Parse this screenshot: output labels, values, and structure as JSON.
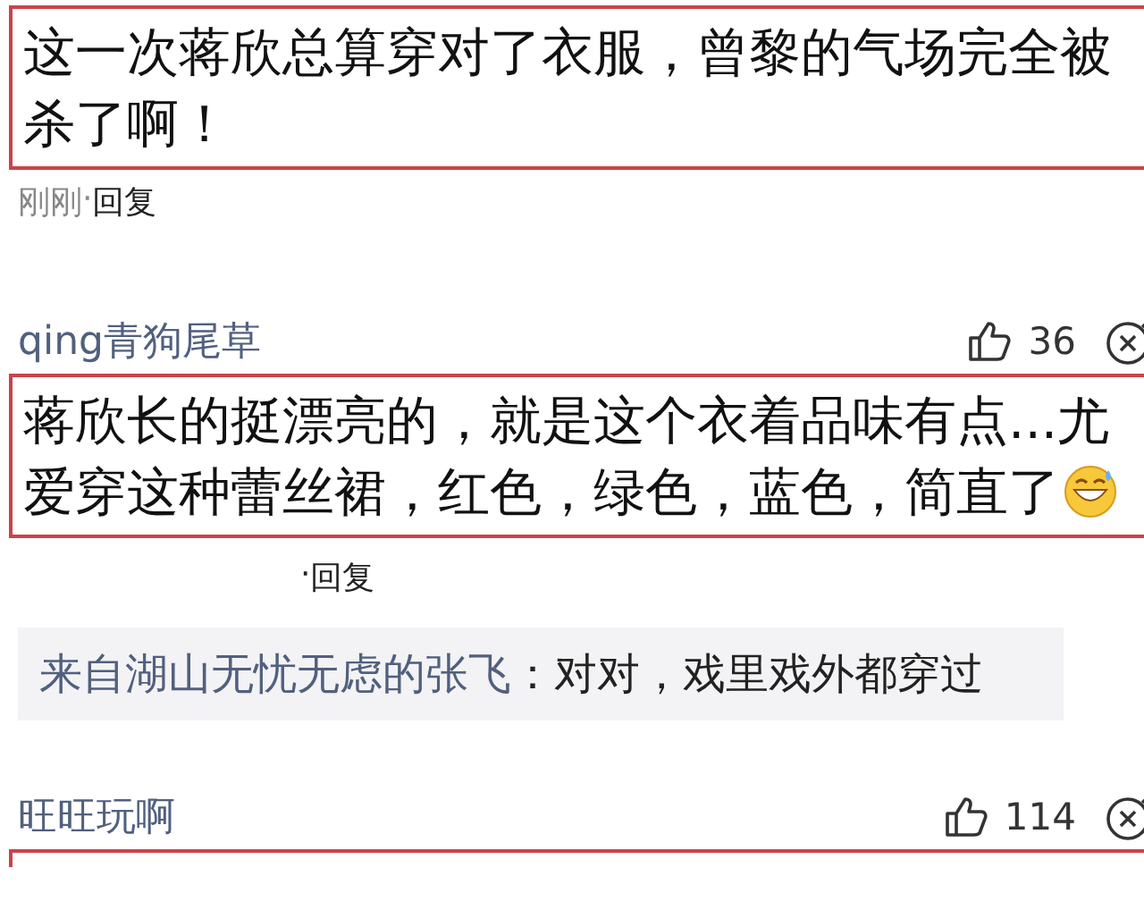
{
  "comments": [
    {
      "text_lines": [
        "这一次蒋欣总算穿对了衣服，曾黎的气场完全被",
        "杀了啊！"
      ],
      "time": "刚刚",
      "separator": "·",
      "reply": "回复",
      "highlighted": true
    },
    {
      "user": "qing青狗尾草",
      "likes": "36",
      "text_lines": [
        "蒋欣长的挺漂亮的，就是这个衣着品味有点...尤",
        "爱穿这种蕾丝裙，红色，绿色，蓝色，简直了"
      ],
      "emoji": true,
      "separator": "·",
      "reply": "回复",
      "highlighted": true,
      "replies": [
        {
          "author": "来自湖山无忧无虑的张飞",
          "text": "：对对，戏里戏外都穿过"
        }
      ]
    },
    {
      "user": "旺旺玩啊",
      "likes": "114",
      "highlighted": true
    }
  ]
}
